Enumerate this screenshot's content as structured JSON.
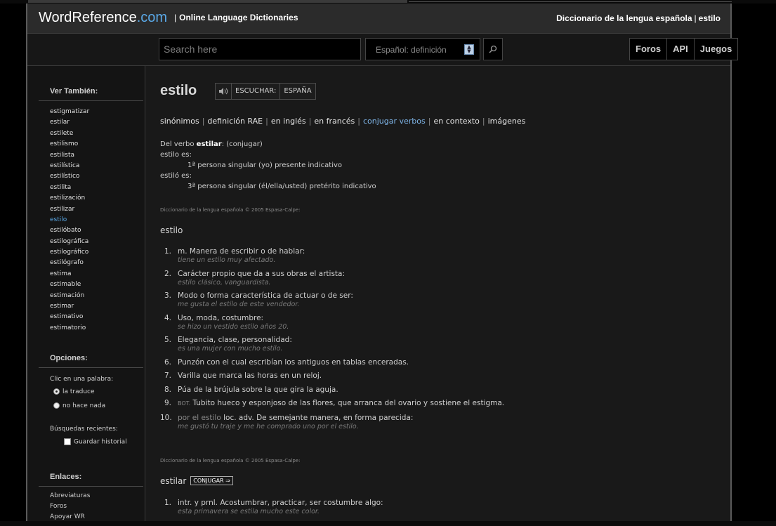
{
  "header": {
    "logo_main": "WordReference",
    "logo_com": ".com",
    "tagline_sep": "|",
    "tagline": "Online Language Dictionaries",
    "dict_name": "Diccionario de la lengua española",
    "dict_sep": "|",
    "dict_word": "estilo"
  },
  "search": {
    "placeholder": "Search here",
    "dictionary": "Español: definición",
    "nav": [
      "Foros",
      "API",
      "Juegos"
    ]
  },
  "sidebar": {
    "see_also_title": "Ver También:",
    "see_also": [
      "estigmatizar",
      "estilar",
      "estilete",
      "estilismo",
      "estilista",
      "estilística",
      "estilístico",
      "estilita",
      "estilización",
      "estilizar",
      "estilo",
      "estilóbato",
      "estilográfica",
      "estilográfico",
      "estilógrafo",
      "estima",
      "estimable",
      "estimación",
      "estimar",
      "estimativo",
      "estimatorio"
    ],
    "active_word": "estilo",
    "options_title": "Opciones:",
    "click_label": "Clic en una palabra:",
    "radio_translate": "la traduce",
    "radio_nothing": "no hace nada",
    "recent_label": "Búsquedas recientes:",
    "save_history": "Guardar historial",
    "links_title": "Enlaces:",
    "links": [
      "Abreviaturas",
      "Foros",
      "Apoyar WR"
    ]
  },
  "main": {
    "word": "estilo",
    "listen": "ESCUCHAR:",
    "region": "ESPAÑA",
    "links": [
      {
        "label": "sinónimos",
        "blue": false
      },
      {
        "label": "definición RAE",
        "blue": false
      },
      {
        "label": "en inglés",
        "blue": false
      },
      {
        "label": "en francés",
        "blue": false
      },
      {
        "label": "conjugar verbos",
        "blue": true
      },
      {
        "label": "en contexto",
        "blue": false
      },
      {
        "label": "imágenes",
        "blue": false
      }
    ],
    "conj_prefix": "Del verbo",
    "conj_verb": "estilar",
    "conj_link": "(conjugar)",
    "form1": "estilo es:",
    "form1_desc": "1ª persona singular (yo) presente indicativo",
    "form2": "estiló es:",
    "form2_desc": "3ª persona singular (él/ella/usted) pretérito indicativo",
    "copyright": "Diccionario de la lengua española © 2005 Espasa-Calpe:",
    "entry1": "estilo",
    "defs1": [
      {
        "n": "1.",
        "text": "m. Manera de escribir o de hablar:",
        "ex": "tiene un estilo muy afectado."
      },
      {
        "n": "2.",
        "text": "Carácter propio que da a sus obras el artista:",
        "ex": "estilo clásico, vanguardista."
      },
      {
        "n": "3.",
        "text": "Modo o forma característica de actuar o de ser:",
        "ex": "me gusta el estilo de este vendedor."
      },
      {
        "n": "4.",
        "text": "Uso, moda, costumbre:",
        "ex": "se hizo un vestido estilo años 20."
      },
      {
        "n": "5.",
        "text": "Elegancia, clase, personalidad:",
        "ex": "es una mujer con mucho estilo."
      },
      {
        "n": "6.",
        "text": "Punzón con el cual escribían los antiguos en tablas enceradas.",
        "ex": ""
      },
      {
        "n": "7.",
        "text": "Varilla que marca las horas en un reloj.",
        "ex": ""
      },
      {
        "n": "8.",
        "text": "Púa de la brújula sobre la que gira la aguja.",
        "ex": ""
      },
      {
        "n": "9.",
        "prefix": "BOT.",
        "text": " Tubito hueco y esponjoso de las flores, que arranca del ovario y sostiene el estigma.",
        "ex": ""
      },
      {
        "n": "10.",
        "lead": "por el estilo",
        "text": " loc. adv. De semejante manera, en forma parecida:",
        "ex": "me gustó tu traje y me he comprado uno por el estilo."
      }
    ],
    "copyright2": "Diccionario de la lengua española © 2005 Espasa-Calpe:",
    "entry2": "estilar",
    "conj_button": "CONJUGAR ⇒",
    "defs2": [
      {
        "n": "1.",
        "text": "intr. y prnl. Acostumbrar, practicar, ser costumbre algo:",
        "ex": "esta primavera se estila mucho este color."
      }
    ]
  }
}
